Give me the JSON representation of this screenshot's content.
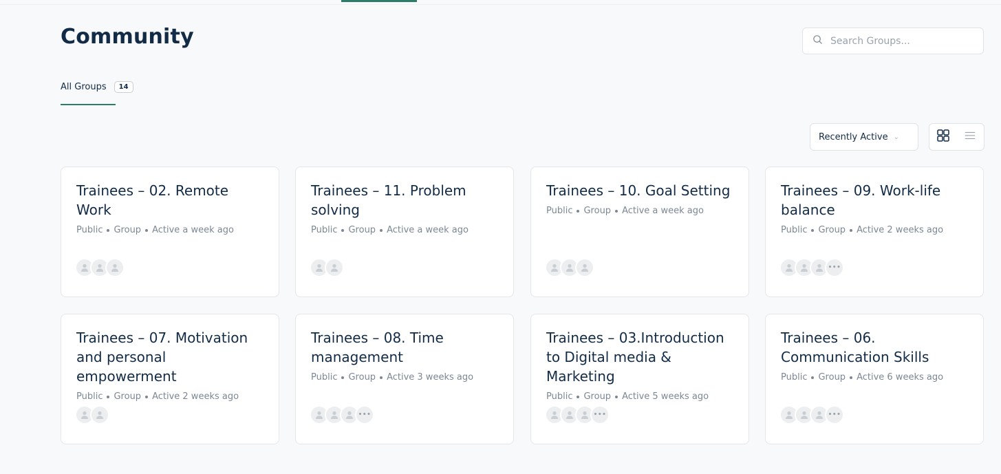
{
  "page": {
    "title": "Community"
  },
  "search": {
    "placeholder": "Search Groups..."
  },
  "tabs": [
    {
      "label": "All Groups",
      "count": "14"
    }
  ],
  "sort": {
    "selected": "Recently Active"
  },
  "groups": [
    {
      "title": "Trainees – 02. Remote Work",
      "privacy": "Public",
      "type": "Group",
      "active": "Active a week ago"
    },
    {
      "title": "Trainees – 11. Problem solving",
      "privacy": "Public",
      "type": "Group",
      "active": "Active a week ago"
    },
    {
      "title": "Trainees – 10. Goal Setting",
      "privacy": "Public",
      "type": "Group",
      "active": "Active a week ago"
    },
    {
      "title": "Trainees – 09. Work-life balance",
      "privacy": "Public",
      "type": "Group",
      "active": "Active 2 weeks ago"
    },
    {
      "title": "Trainees – 07. Motivation and personal empowerment",
      "privacy": "Public",
      "type": "Group",
      "active": "Active 2 weeks ago"
    },
    {
      "title": "Trainees – 08. Time management",
      "privacy": "Public",
      "type": "Group",
      "active": "Active 3 weeks ago"
    },
    {
      "title": "Trainees – 03.Introduction to Digital media & Marketing",
      "privacy": "Public",
      "type": "Group",
      "active": "Active 5 weeks ago"
    },
    {
      "title": "Trainees – 06. Communication Skills",
      "privacy": "Public",
      "type": "Group",
      "active": "Active 6 weeks ago"
    }
  ],
  "colors": {
    "accent": "#2e7d6a",
    "text": "#122b46",
    "muted": "#7c8794",
    "background": "#f8f9fa"
  },
  "icons": {
    "search": "search-icon",
    "grid_view": "grid-view-icon",
    "list_view": "list-view-icon",
    "avatar": "user-icon",
    "more": "ellipsis-icon",
    "sort_chevron": "chevron-down-icon"
  }
}
